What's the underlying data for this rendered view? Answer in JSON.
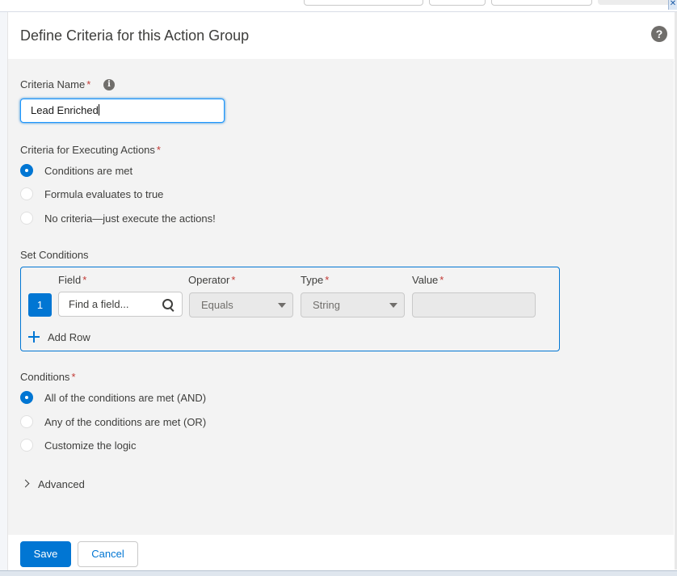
{
  "colors": {
    "brand": "#0176d3",
    "required": "#c23934",
    "panel": "#f3f3f3"
  },
  "header": {
    "title": "Define Criteria for this Action Group",
    "help_icon": "?"
  },
  "criteria_name": {
    "label": "Criteria Name",
    "required": "*",
    "info_icon": "i",
    "value": "Lead Enriched"
  },
  "criteria_exec": {
    "label": "Criteria for Executing Actions",
    "required": "*",
    "options": [
      {
        "label": "Conditions are met",
        "checked": true
      },
      {
        "label": "Formula evaluates to true",
        "checked": false
      },
      {
        "label": "No criteria—just execute the actions!",
        "checked": false
      }
    ]
  },
  "set_conditions": {
    "label": "Set Conditions",
    "columns": {
      "field": "Field",
      "operator": "Operator",
      "type": "Type",
      "value": "Value",
      "required": "*"
    },
    "row": {
      "number": "1",
      "field_placeholder": "Find a field...",
      "operator": "Equals",
      "type": "String",
      "value": ""
    },
    "add_row": "Add Row"
  },
  "conditions": {
    "label": "Conditions",
    "required": "*",
    "options": [
      {
        "label": "All of the conditions are met (AND)",
        "checked": true
      },
      {
        "label": "Any of the conditions are met (OR)",
        "checked": false
      },
      {
        "label": "Customize the logic",
        "checked": false
      }
    ]
  },
  "advanced": {
    "label": "Advanced"
  },
  "footer": {
    "save": "Save",
    "cancel": "Cancel"
  }
}
